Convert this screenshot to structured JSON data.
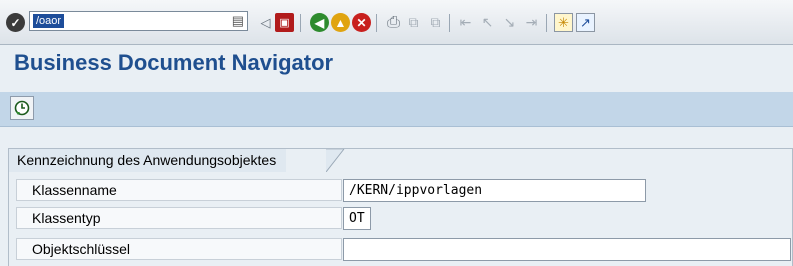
{
  "toolbar": {
    "command_field_value": "/oaor"
  },
  "title": "Business Document Navigator",
  "group": {
    "title": "Kennzeichnung des Anwendungsobjektes",
    "fields": [
      {
        "label": "Klassenname",
        "value": "/KERN/ippvorlagen"
      },
      {
        "label": "Klassentyp",
        "value": "OT"
      },
      {
        "label": "Objektschlüssel",
        "value": ""
      }
    ]
  },
  "icons": {
    "enter": "check-circle-icon",
    "save": "floppy-disk-icon",
    "back": "green-arrow-icon",
    "exit": "yellow-up-arrow-icon",
    "cancel": "red-x-icon",
    "print": "printer-icon",
    "execute": "execute-clock-icon"
  },
  "colors": {
    "title": "#1f4f8f",
    "app_toolbar": "#c2d6e8",
    "command_selection": "#1d4d9a"
  }
}
